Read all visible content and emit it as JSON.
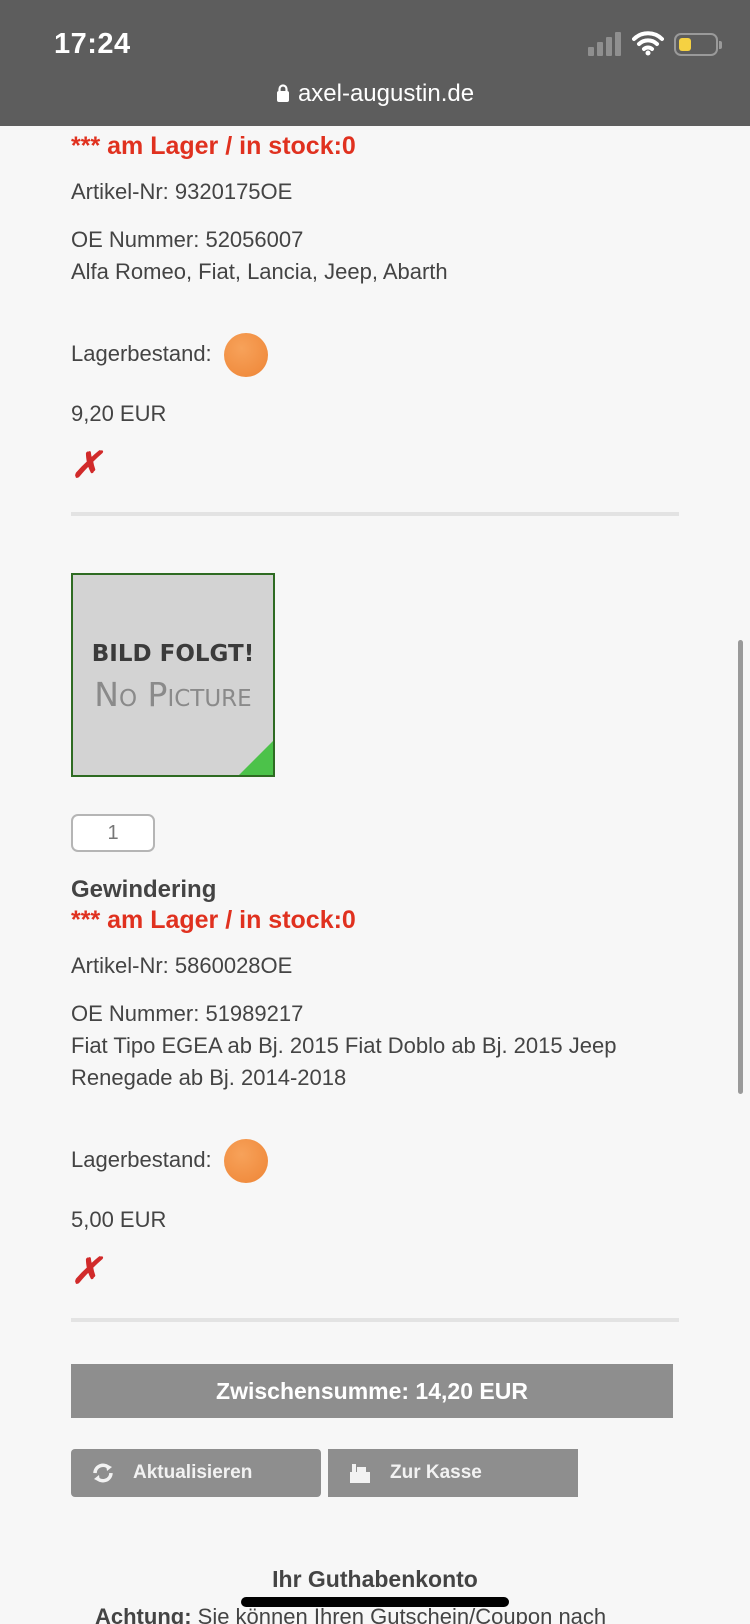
{
  "status": {
    "time": "17:24",
    "url": "axel-augustin.de"
  },
  "items": [
    {
      "stock_line": "*** am Lager / in stock:0",
      "artikel": "Artikel-Nr: 9320175OE",
      "oe": "OE Nummer: 52056007",
      "vehicles": "Alfa Romeo, Fiat, Lancia, Jeep, Abarth",
      "lager_label": "Lagerbestand:",
      "price": "9,20 EUR",
      "remove": "✗"
    },
    {
      "picture_line1": "BILD FOLGT!",
      "picture_line2": "No Picture",
      "qty": "1",
      "name": "Gewindering",
      "stock_line": "*** am Lager / in stock:0",
      "artikel": "Artikel-Nr: 5860028OE",
      "oe": "OE Nummer: 51989217",
      "vehicles": "Fiat Tipo EGEA ab Bj. 2015 Fiat Doblo ab Bj. 2015 Jeep Renegade ab Bj. 2014-2018",
      "lager_label": "Lagerbestand:",
      "price": "5,00 EUR",
      "remove": "✗"
    }
  ],
  "stock_indicator_color": "#ee8536",
  "subtotal": "Zwischensumme: 14,20 EUR",
  "buttons": {
    "update": "Aktualisieren",
    "checkout": "Zur Kasse"
  },
  "guthaben_title": "Ihr Guthabenkonto",
  "achtung_label": "Achtung:",
  "achtung_text": " Sie können Ihren Gutschein/Coupon nach"
}
